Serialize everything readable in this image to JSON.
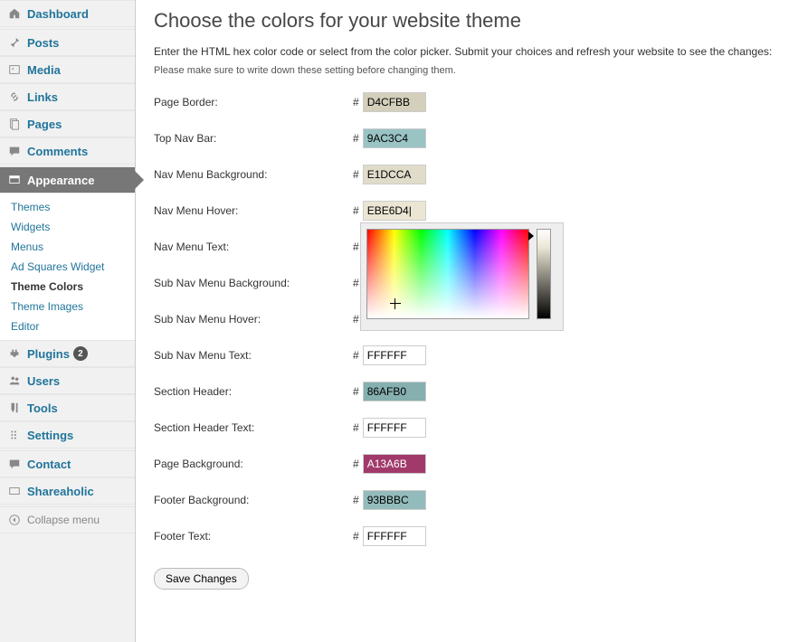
{
  "sidebar": {
    "items": [
      {
        "label": "Dashboard",
        "icon": "home"
      },
      {
        "label": "Posts",
        "icon": "pin"
      },
      {
        "label": "Media",
        "icon": "media"
      },
      {
        "label": "Links",
        "icon": "link"
      },
      {
        "label": "Pages",
        "icon": "page"
      },
      {
        "label": "Comments",
        "icon": "comment"
      },
      {
        "label": "Appearance",
        "icon": "appearance",
        "active": true
      },
      {
        "label": "Plugins",
        "icon": "plugin",
        "badge": "2"
      },
      {
        "label": "Users",
        "icon": "users"
      },
      {
        "label": "Tools",
        "icon": "tools"
      },
      {
        "label": "Settings",
        "icon": "settings"
      },
      {
        "label": "Contact",
        "icon": "contact"
      },
      {
        "label": "Shareaholic",
        "icon": "share"
      },
      {
        "label": "Collapse menu",
        "icon": "collapse"
      }
    ],
    "submenu": [
      {
        "label": "Themes"
      },
      {
        "label": "Widgets"
      },
      {
        "label": "Menus"
      },
      {
        "label": "Ad Squares Widget"
      },
      {
        "label": "Theme Colors",
        "current": true
      },
      {
        "label": "Theme Images"
      },
      {
        "label": "Editor"
      }
    ]
  },
  "page": {
    "title": "Choose the colors for your website theme",
    "description": "Enter the HTML hex color code or select from the color picker. Submit your choices and refresh your website to see the changes:",
    "note": "Please make sure to write down these setting before changing them."
  },
  "colors": [
    {
      "label": "Page Border:",
      "value": "D4CFBB",
      "bg": "#D4CFBB"
    },
    {
      "label": "Top Nav Bar:",
      "value": "9AC3C4",
      "bg": "#9AC3C4"
    },
    {
      "label": "Nav Menu Background:",
      "value": "E1DCCA",
      "bg": "#E1DCCA"
    },
    {
      "label": "Nav Menu Hover:",
      "value": "EBE6D4|",
      "bg": "#EBE6D4",
      "picker": true
    },
    {
      "label": "Nav Menu Text:",
      "value": "",
      "bg": ""
    },
    {
      "label": "Sub Nav Menu Background:",
      "value": "",
      "bg": ""
    },
    {
      "label": "Sub Nav Menu Hover:",
      "value": "",
      "bg": ""
    },
    {
      "label": "Sub Nav Menu Text:",
      "value": "FFFFFF",
      "bg": "#FFFFFF"
    },
    {
      "label": "Section Header:",
      "value": "86AFB0",
      "bg": "#86AFB0"
    },
    {
      "label": "Section Header Text:",
      "value": "FFFFFF",
      "bg": "#FFFFFF"
    },
    {
      "label": "Page Background:",
      "value": "A13A6B",
      "bg": "#A13A6B",
      "fg": "#fff"
    },
    {
      "label": "Footer Background:",
      "value": "93BBBC",
      "bg": "#93BBBC"
    },
    {
      "label": "Footer Text:",
      "value": "FFFFFF",
      "bg": "#FFFFFF"
    }
  ],
  "save_label": "Save Changes"
}
